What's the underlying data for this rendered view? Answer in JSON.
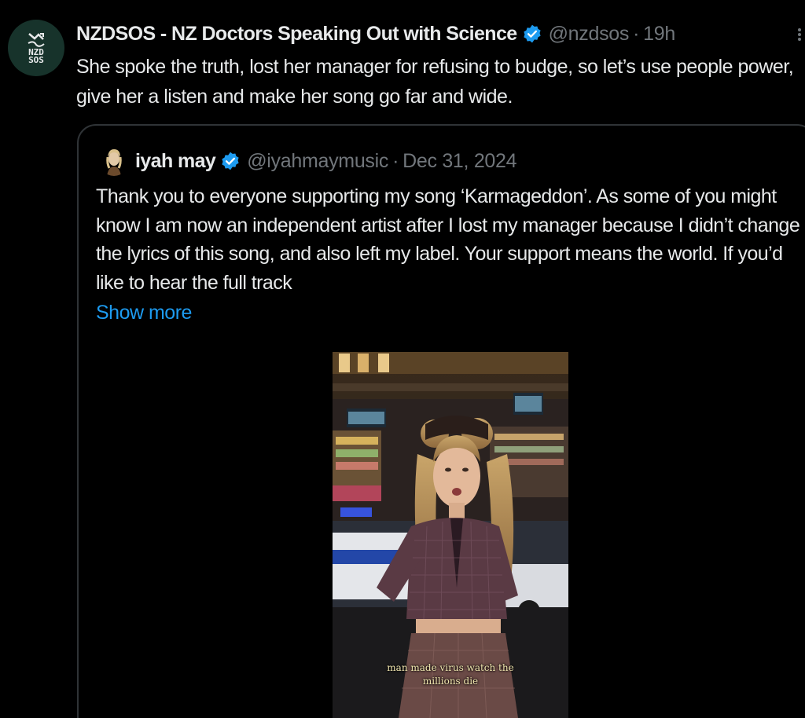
{
  "post": {
    "author_name": "NZDSOS - NZ Doctors Speaking Out with Science",
    "handle": "@nzdsos",
    "separator": "·",
    "time": "19h",
    "avatar_text_line1": "NZD",
    "avatar_text_line2": "SOS",
    "text": "She spoke the truth, lost her manager for refusing to budge, so let’s use people power, give her a listen and make her song go far and wide."
  },
  "quoted": {
    "author_name": "iyah may",
    "handle": "@iyahmaymusic",
    "separator": "·",
    "date": "Dec 31, 2024",
    "text": "Thank you to everyone supporting my song ‘Karmageddon’. As some of you might know I am now an independent artist after I lost my manager because I didn’t change the lyrics of this song, and also left my label. Your support means the world. If you’d like to hear the full track",
    "show_more": "Show more",
    "video_caption_line1": "man made virus watch the",
    "video_caption_line2": "millions die"
  },
  "colors": {
    "background": "#000000",
    "text_primary": "#e7e9ea",
    "text_secondary": "#71767b",
    "link": "#1d9bf0",
    "verified": "#1d9bf0",
    "border": "#2f3336",
    "avatar_bg": "#17332b"
  },
  "icons": {
    "verified": "verified-badge-icon",
    "more": "more-options-icon"
  }
}
